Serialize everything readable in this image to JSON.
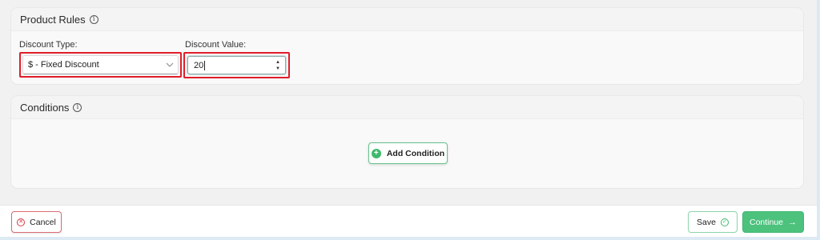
{
  "product_rules": {
    "title": "Product Rules",
    "discount_type": {
      "label": "Discount Type:",
      "selected": "$ - Fixed Discount"
    },
    "discount_value": {
      "label": "Discount Value:",
      "value": "20"
    }
  },
  "conditions": {
    "title": "Conditions",
    "add_button_label": "Add Condition"
  },
  "footer": {
    "cancel_label": "Cancel",
    "save_label": "Save",
    "continue_label": "Continue"
  },
  "icons": {
    "info": "info-icon",
    "chevron": "chevron-down-icon",
    "add": "plus-circle-icon",
    "cancel": "x-circle-icon",
    "save": "check-circle-icon",
    "continue": "arrow-right-icon"
  },
  "colors": {
    "accent_green": "#4cc27d",
    "highlight_red": "#e01e2a",
    "cancel_red": "#d43a45"
  }
}
